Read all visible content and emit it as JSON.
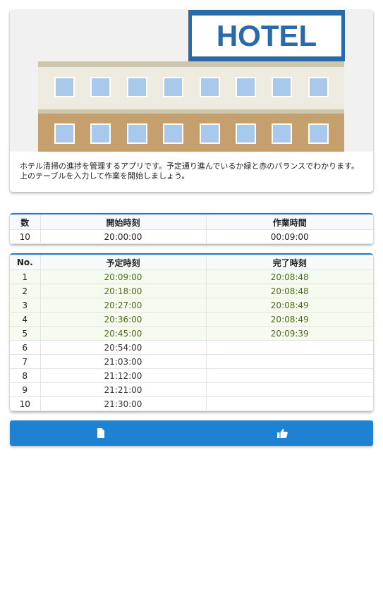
{
  "hero": {
    "sign_text": "HOTEL",
    "description": "ホテル清掃の進捗を管理するアプリです。予定通り進んでいるか緑と赤のバランスでわかります。上のテーブルを入力して作業を開始しましょう。"
  },
  "settings_table": {
    "headers": [
      "数",
      "開始時刻",
      "作業時間"
    ],
    "row": {
      "count": "10",
      "start_time": "20:00:00",
      "work_time": "00:09:00"
    }
  },
  "progress_table": {
    "headers": [
      "No.",
      "予定時刻",
      "完了時刻"
    ],
    "rows": [
      {
        "no": "1",
        "planned": "20:09:00",
        "done": "20:08:48"
      },
      {
        "no": "2",
        "planned": "20:18:00",
        "done": "20:08:48"
      },
      {
        "no": "3",
        "planned": "20:27:00",
        "done": "20:08:49"
      },
      {
        "no": "4",
        "planned": "20:36:00",
        "done": "20:08:49"
      },
      {
        "no": "5",
        "planned": "20:45:00",
        "done": "20:09:39"
      },
      {
        "no": "6",
        "planned": "20:54:00",
        "done": ""
      },
      {
        "no": "7",
        "planned": "21:03:00",
        "done": ""
      },
      {
        "no": "8",
        "planned": "21:12:00",
        "done": ""
      },
      {
        "no": "9",
        "planned": "21:21:00",
        "done": ""
      },
      {
        "no": "10",
        "planned": "21:30:00",
        "done": ""
      }
    ]
  },
  "buttons": {
    "left_icon": "document-icon",
    "right_icon": "thumbs-up-icon"
  },
  "colors": {
    "accent": "#1e82d2",
    "done_row_bg": "#f6fbf0",
    "done_text": "#4c6a1b"
  }
}
